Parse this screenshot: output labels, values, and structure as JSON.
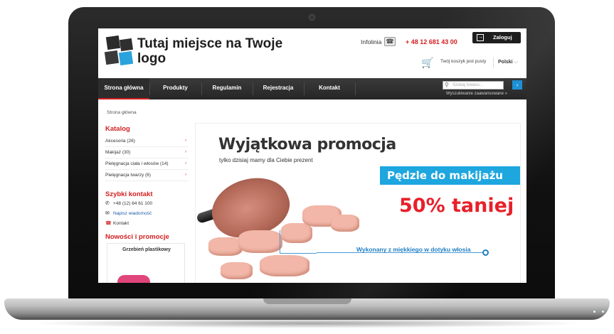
{
  "header": {
    "logo_text": "Tutaj miejsce na Twoje logo",
    "infolinia_label": "Infolinia",
    "phone_number": "+ 48 12 681 43 00",
    "login_label": "Zaloguj",
    "cart_text": "Twój koszyk jest pusty",
    "language": "Polski"
  },
  "nav": {
    "items": [
      {
        "label": "Strona główna",
        "active": true
      },
      {
        "label": "Produkty"
      },
      {
        "label": "Regulamin"
      },
      {
        "label": "Rejestracja"
      },
      {
        "label": "Kontakt"
      }
    ],
    "search_placeholder": "Szukaj towaru...",
    "advanced_search": "Wyszukiwanie zaawansowane »"
  },
  "breadcrumb": "Strona główna",
  "sidebar": {
    "catalog_heading": "Katalog",
    "categories": [
      {
        "label": "Akcesoria (26)"
      },
      {
        "label": "Makijaż (30)"
      },
      {
        "label": "Pielęgnacja ciała i włosów (14)"
      },
      {
        "label": "Pielęgnacja twarzy (6)"
      }
    ],
    "quick_contact_heading": "Szybki kontakt",
    "contact_phone": "+48 (12) 64 61 100",
    "contact_message": "Napisz wiadomość",
    "contact_link": "Kontakt",
    "news_heading": "Nowości i promocje",
    "featured_product": "Grzebień plastikowy"
  },
  "promo": {
    "title": "Wyjątkowa promocja",
    "subtitle": "tylko dzisiaj mamy dla Ciebie prezent",
    "band_text": "Pędzle do makijażu",
    "discount": "50% taniej",
    "annotation": "Wykonany z miękkiego w dotyku włosia"
  },
  "colors": {
    "accent_red": "#d31f1f",
    "accent_blue": "#1ea6df",
    "nav_dark": "#2d2d2d"
  }
}
